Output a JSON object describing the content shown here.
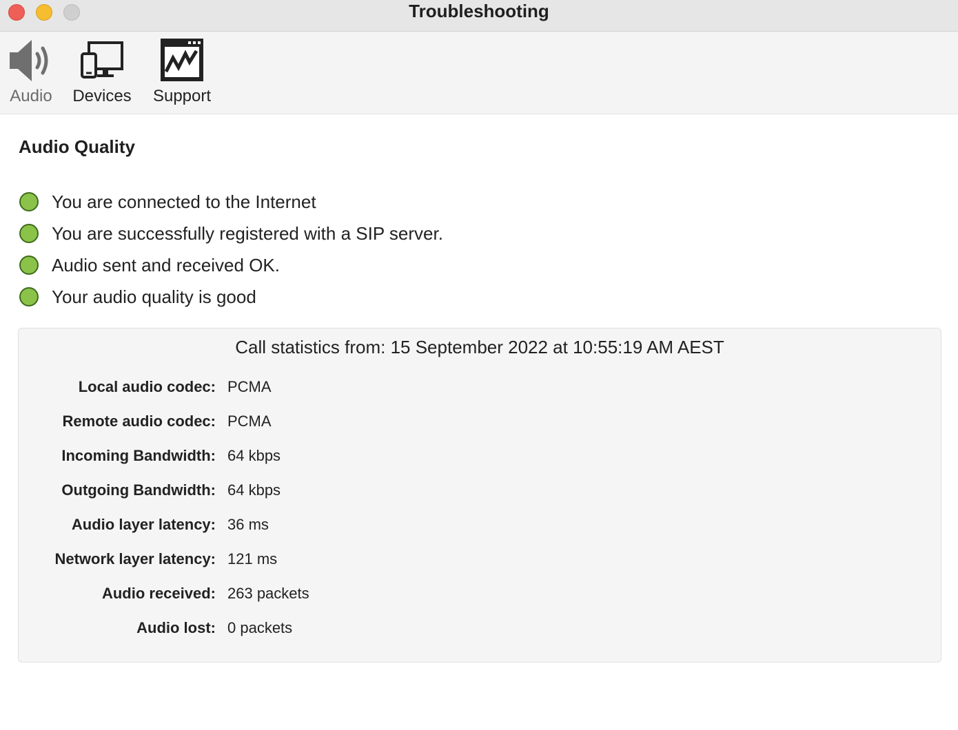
{
  "window": {
    "title": "Troubleshooting"
  },
  "toolbar": {
    "items": [
      {
        "label": "Audio",
        "icon": "speaker-icon",
        "active": true
      },
      {
        "label": "Devices",
        "icon": "devices-icon",
        "active": false
      },
      {
        "label": "Support",
        "icon": "support-chart-icon",
        "active": false
      }
    ]
  },
  "audio_quality": {
    "title": "Audio Quality",
    "status_color": "#8bc34a",
    "statuses": [
      {
        "text": "You are connected to the Internet"
      },
      {
        "text": "You are successfully registered with a SIP server."
      },
      {
        "text": "Audio sent and received OK."
      },
      {
        "text": "Your audio quality is good"
      }
    ]
  },
  "stats": {
    "header": "Call statistics from: 15 September 2022 at 10:55:19 AM AEST",
    "rows": [
      {
        "label": "Local audio codec:",
        "value": "PCMA"
      },
      {
        "label": "Remote audio codec:",
        "value": "PCMA"
      },
      {
        "label": "Incoming Bandwidth:",
        "value": "64 kbps"
      },
      {
        "label": "Outgoing Bandwidth:",
        "value": "64 kbps"
      },
      {
        "label": "Audio layer latency:",
        "value": "36 ms"
      },
      {
        "label": "Network layer latency:",
        "value": "121 ms"
      },
      {
        "label": "Audio received:",
        "value": "263 packets"
      },
      {
        "label": "Audio lost:",
        "value": "0 packets"
      }
    ]
  }
}
